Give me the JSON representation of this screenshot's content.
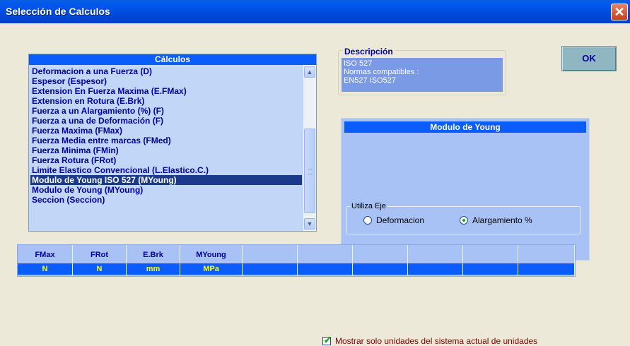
{
  "window": {
    "title": "Selección de Calculos"
  },
  "calculos": {
    "header": "Cálculos",
    "items": [
      "Deformacion a una Fuerza (D)",
      "Espesor (Espesor)",
      "Extension En Fuerza Maxima (E.FMax)",
      "Extension en Rotura (E.Brk)",
      "Fuerza a un Alargamiento (%) (F)",
      "Fuerza a una de Deformación (F)",
      "Fuerza Maxima (FMax)",
      "Fuerza Media entre marcas (FMed)",
      "Fuerza Minima (FMin)",
      "Fuerza Rotura (FRot)",
      "Limite Elastico Convencional (L.Elastico.C.)",
      "Modulo de Young ISO 527 (MYoung)",
      "Modulo de Young (MYoung)",
      "Seccion (Seccion)"
    ],
    "selected_index": 11
  },
  "descripcion": {
    "label": "Descripción",
    "line1": "ISO 527",
    "line2": "Normas compatibles :",
    "line3": "EN527 ISO527"
  },
  "ok_label": "OK",
  "young_panel": {
    "header": "Modulo de Young",
    "utiliza_eje": "Utiliza Eje",
    "opt_deformacion": "Deformacion",
    "opt_alargamiento": "Alargamiento %",
    "selected": "Alargamiento %"
  },
  "units_table": {
    "columns": [
      {
        "head": "FMax",
        "unit": "N"
      },
      {
        "head": "FRot",
        "unit": "N"
      },
      {
        "head": "E.Brk",
        "unit": "mm"
      },
      {
        "head": "MYoung",
        "unit": "MPa"
      },
      {
        "head": "",
        "unit": ""
      },
      {
        "head": "",
        "unit": ""
      },
      {
        "head": "",
        "unit": ""
      },
      {
        "head": "",
        "unit": ""
      },
      {
        "head": "",
        "unit": ""
      },
      {
        "head": "",
        "unit": ""
      }
    ]
  },
  "checkbox": {
    "label": "Mostrar solo unidades del sistema actual de unidades",
    "checked": true
  },
  "colors": {
    "titlebar": "#0046D6",
    "list_bg": "#C2D6F8",
    "header_blue": "#0A5DFA",
    "selected_row": "#1C3A8A",
    "text_navy": "#0000A0"
  }
}
